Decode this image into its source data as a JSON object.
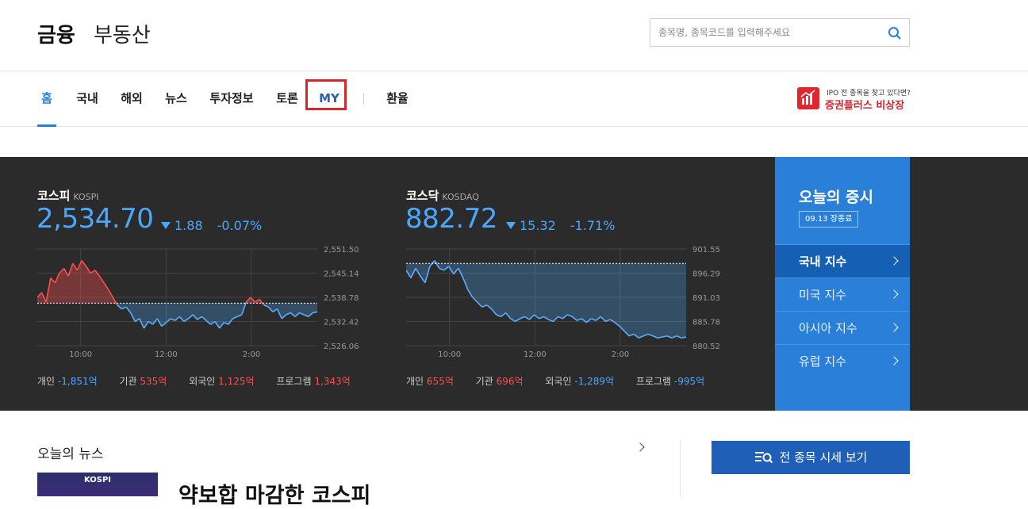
{
  "brand": {
    "finance": "금융",
    "realestate": "부동산"
  },
  "search": {
    "placeholder": "종목명, 종목코드를 입력해주세요"
  },
  "nav": {
    "items": [
      {
        "label": "홈",
        "active": true
      },
      {
        "label": "국내"
      },
      {
        "label": "해외"
      },
      {
        "label": "뉴스"
      },
      {
        "label": "투자정보"
      },
      {
        "label": "토론"
      },
      {
        "label": "MY",
        "highlighted": true
      },
      {
        "label": "환율"
      }
    ]
  },
  "promo": {
    "line1": "IPO 전 종목을 찾고 있다면?",
    "line2": "증권플러스 비상장",
    "icon_text": "비상장"
  },
  "kospi": {
    "name": "코스피",
    "code": "KOSPI",
    "value": "2,534.70",
    "change": "1.88",
    "change_pct": "-0.07%",
    "y_ticks": [
      "2,551.50",
      "2,545.14",
      "2,538.78",
      "2,532.42",
      "2,526.06"
    ],
    "x_ticks": [
      "10:00",
      "12:00",
      "2:00"
    ],
    "investors": [
      {
        "label": "개인",
        "value": "-1,851억",
        "dir": "down"
      },
      {
        "label": "기관",
        "value": "535억",
        "dir": "up"
      },
      {
        "label": "외국인",
        "value": "1,125억",
        "dir": "up"
      },
      {
        "label": "프로그램",
        "value": "1,343억",
        "dir": "up"
      }
    ]
  },
  "kosdaq": {
    "name": "코스닥",
    "code": "KOSDAQ",
    "value": "882.72",
    "change": "15.32",
    "change_pct": "-1.71%",
    "y_ticks": [
      "901.55",
      "896.29",
      "891.03",
      "885.78",
      "880.52"
    ],
    "x_ticks": [
      "10:00",
      "12:00",
      "2:00"
    ],
    "investors": [
      {
        "label": "개인",
        "value": "655억",
        "dir": "up"
      },
      {
        "label": "기관",
        "value": "696억",
        "dir": "up"
      },
      {
        "label": "외국인",
        "value": "-1,289억",
        "dir": "down"
      },
      {
        "label": "프로그램",
        "value": "-995억",
        "dir": "down"
      }
    ]
  },
  "today": {
    "title": "오늘의 증시",
    "date": "09.13 장종료",
    "menu": [
      "국내 지수",
      "미국 지수",
      "아시아 지수",
      "유럽 지수"
    ]
  },
  "news": {
    "title": "오늘의 뉴스",
    "thumb_label": "KOSPI",
    "headline": "약보합 마감한 코스피"
  },
  "all_button": {
    "label": "전 종목 시세 보기"
  },
  "colors": {
    "accent": "#2a80d8",
    "down": "#4aa8ff",
    "up": "#ff4d4d",
    "panel": "#2b2b2b",
    "highlight_box": "#d6262e"
  }
}
